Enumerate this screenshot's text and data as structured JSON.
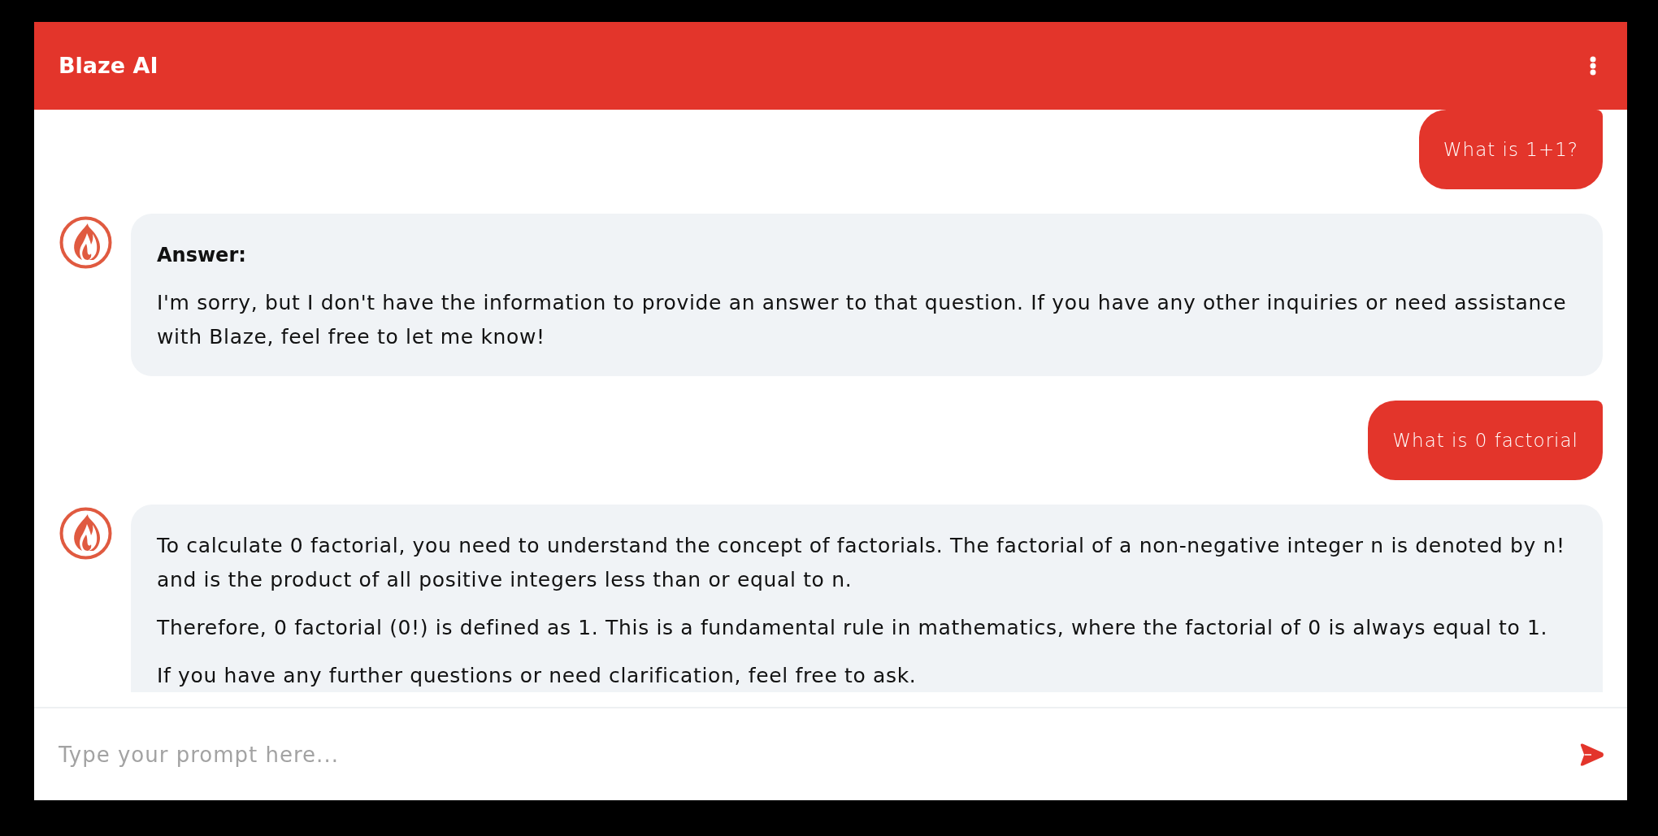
{
  "header": {
    "title": "Blaze AI"
  },
  "messages": [
    {
      "kind": "user",
      "text": "What is 1+1?"
    },
    {
      "kind": "bot",
      "paragraphs": [
        {
          "kind": "heading",
          "text": "Answer:"
        },
        {
          "kind": "text",
          "text": "I'm sorry, but I don't have the information to provide an answer to that question. If you have any other inquiries or need assistance with Blaze, feel free to let me know!"
        }
      ]
    },
    {
      "kind": "user",
      "text": "What is 0 factorial"
    },
    {
      "kind": "bot",
      "paragraphs": [
        {
          "kind": "text",
          "text": "To calculate 0 factorial, you need to understand the concept of factorials. The factorial of a non-negative integer n is denoted by n! and is the product of all positive integers less than or equal to n."
        },
        {
          "kind": "text",
          "text": "Therefore, 0 factorial (0!) is defined as 1. This is a fundamental rule in mathematics, where the factorial of 0 is always equal to 1."
        },
        {
          "kind": "text",
          "text": "If you have any further questions or need clarification, feel free to ask."
        }
      ]
    }
  ],
  "composer": {
    "placeholder": "Type your prompt here..."
  }
}
